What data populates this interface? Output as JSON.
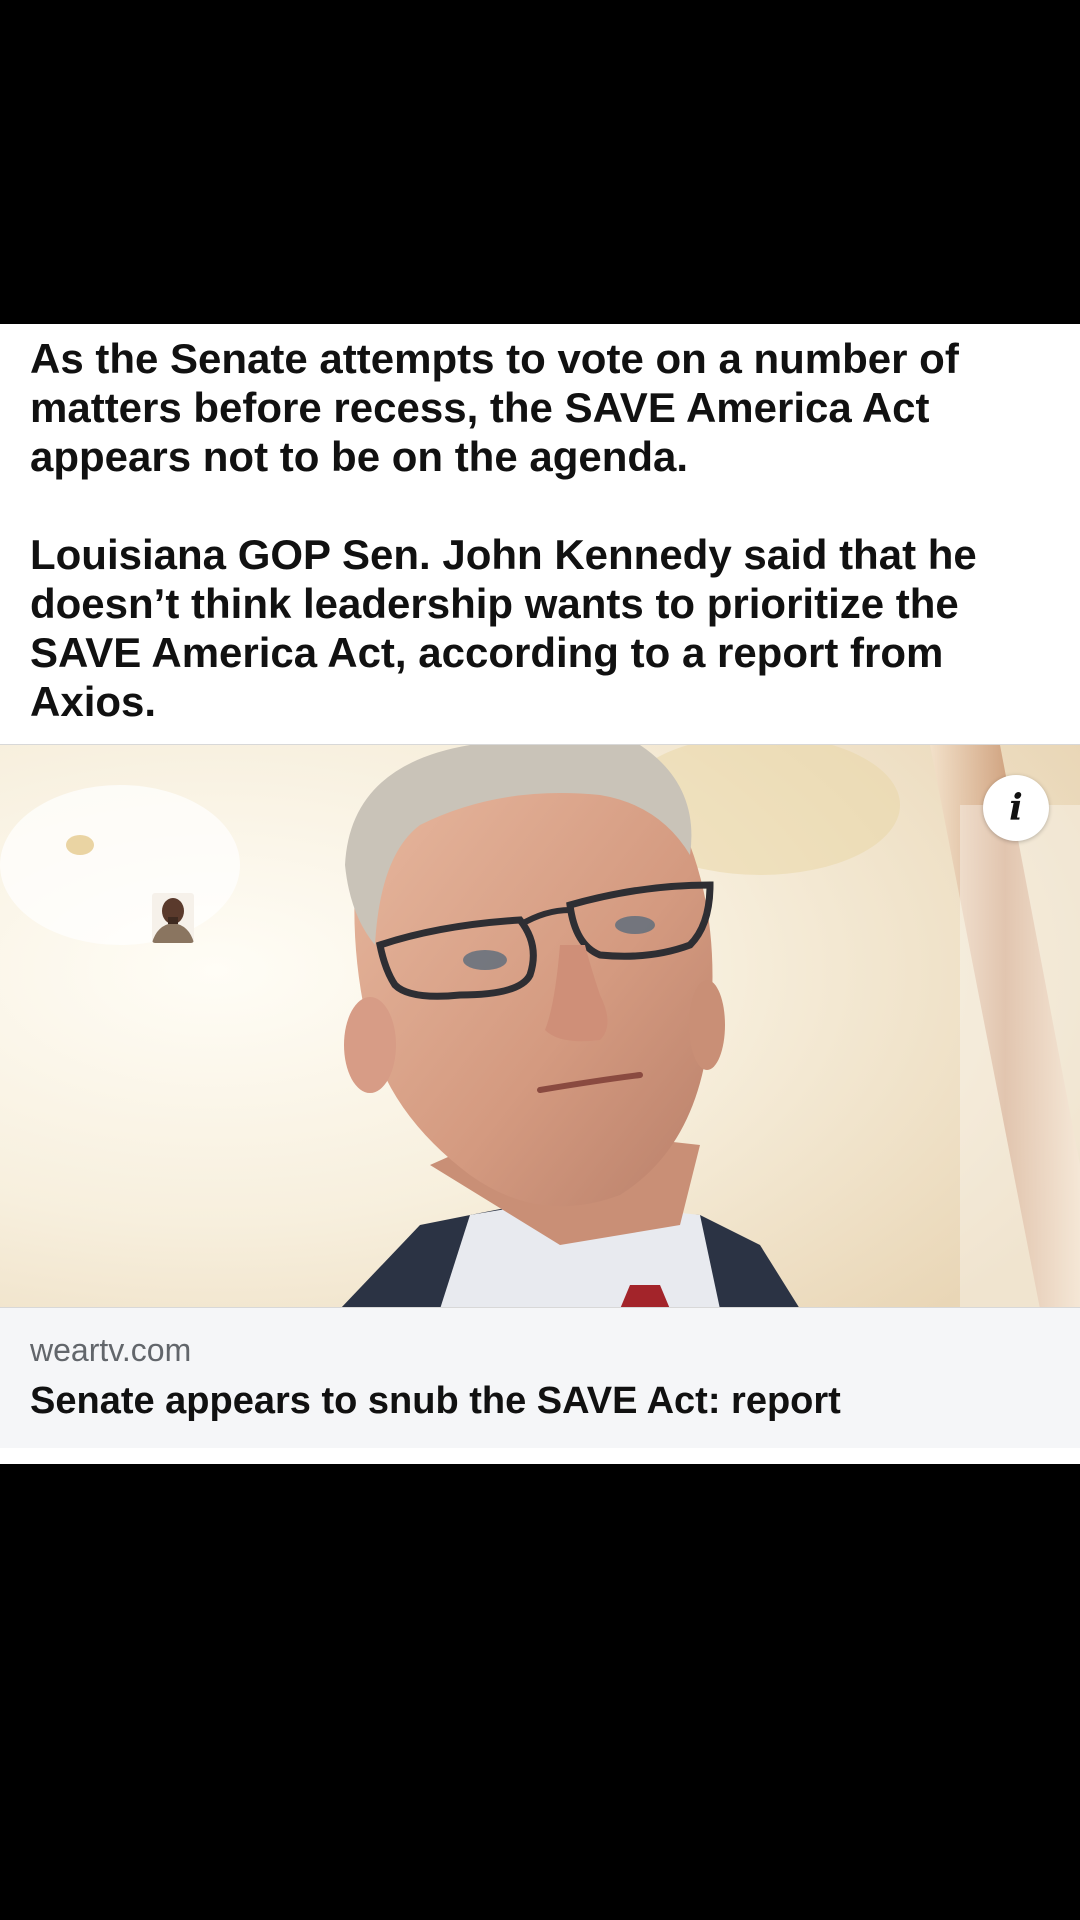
{
  "post": {
    "paragraphs": [
      "As the Senate attempts to vote on a number of\nmatters before recess, the SAVE America Act\nappears not to be on the agenda.",
      "Louisiana GOP Sen. John Kennedy said that he\ndoesn’t think leadership wants to prioritize the\nSAVE America Act, according to a report from\nAxios."
    ]
  },
  "link_preview": {
    "info_icon": "info-icon",
    "info_glyph": "i",
    "domain": "weartv.com",
    "headline": "Senate appears to snub the SAVE Act: report"
  },
  "colors": {
    "background": "#000000",
    "card": "#ffffff",
    "footer": "#f5f6f8",
    "text": "#111111",
    "domain_text": "#62666b"
  }
}
